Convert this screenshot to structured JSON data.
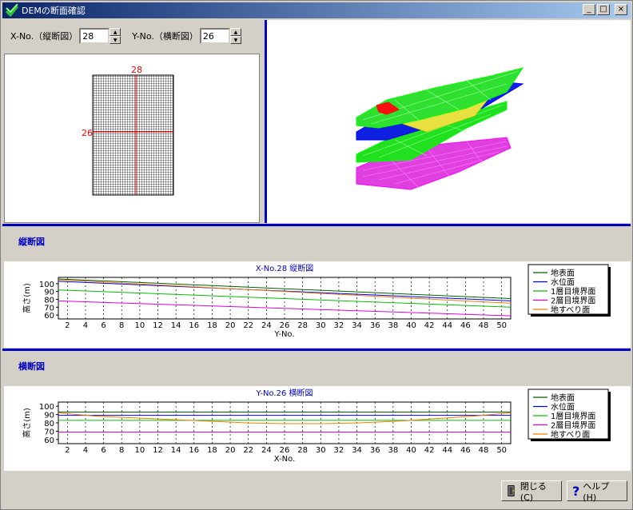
{
  "window": {
    "title": "DEMの断面確認",
    "min_label": "_",
    "max_label": "□",
    "close_label": "×"
  },
  "controls": {
    "x_label": "X-No.（縦断図）",
    "x_value": "28",
    "y_label": "Y-No.（横断図）",
    "y_value": "26"
  },
  "grid": {
    "x_mark": "28",
    "y_mark": "26"
  },
  "longitudinal": {
    "header": "縦断図",
    "chart_data": {
      "type": "line",
      "title": "X-No.28 縦断図",
      "xlabel": "Y-No.",
      "ylabel": "高さ(m)",
      "x": [
        1,
        51
      ],
      "xticks": [
        2,
        4,
        6,
        8,
        10,
        12,
        14,
        16,
        18,
        20,
        22,
        24,
        26,
        28,
        30,
        32,
        34,
        36,
        38,
        40,
        42,
        44,
        46,
        48,
        50
      ],
      "yticks": [
        60,
        70,
        80,
        90,
        100
      ],
      "ylim": [
        55,
        108
      ],
      "xlim": [
        1,
        51
      ],
      "series": [
        {
          "name": "地表面",
          "color": "#006000",
          "values": [
            106,
            81
          ]
        },
        {
          "name": "水位面",
          "color": "#0000ff",
          "values": [
            103,
            78
          ]
        },
        {
          "name": "1層目境界面",
          "color": "#00c000",
          "values": [
            92,
            70
          ]
        },
        {
          "name": "2層目境界面",
          "color": "#e000e0",
          "values": [
            78,
            59
          ]
        },
        {
          "name": "地すべり面",
          "color": "#f08000",
          "values": [
            105,
            75
          ]
        }
      ]
    }
  },
  "cross": {
    "header": "横断図",
    "chart_data": {
      "type": "line",
      "title": "Y-No.26 横断図",
      "xlabel": "X-No.",
      "ylabel": "高さ(m)",
      "xticks": [
        2,
        4,
        6,
        8,
        10,
        12,
        14,
        16,
        18,
        20,
        22,
        24,
        26,
        28,
        30,
        32,
        34,
        36,
        38,
        40,
        42,
        44,
        46,
        48,
        50
      ],
      "yticks": [
        60,
        70,
        80,
        90,
        100
      ],
      "ylim": [
        55,
        105
      ],
      "xlim": [
        1,
        51
      ],
      "series": [
        {
          "name": "地表面",
          "color": "#006000",
          "values": [
            93,
            93
          ]
        },
        {
          "name": "水位面",
          "color": "#0000ff",
          "values": [
            89,
            89
          ]
        },
        {
          "name": "1層目境界面",
          "color": "#00c000",
          "values": [
            83,
            83
          ]
        },
        {
          "name": "2層目境界面",
          "color": "#e000e0",
          "values": [
            69,
            69
          ]
        },
        {
          "name": "地すべり面",
          "color": "#f08000",
          "values": [
            92,
            88,
            86,
            84,
            82,
            80,
            79,
            79,
            80,
            82,
            85,
            88,
            92
          ]
        }
      ]
    }
  },
  "buttons": {
    "close": "閉じる(C)",
    "help": "ヘルプ(H)"
  }
}
